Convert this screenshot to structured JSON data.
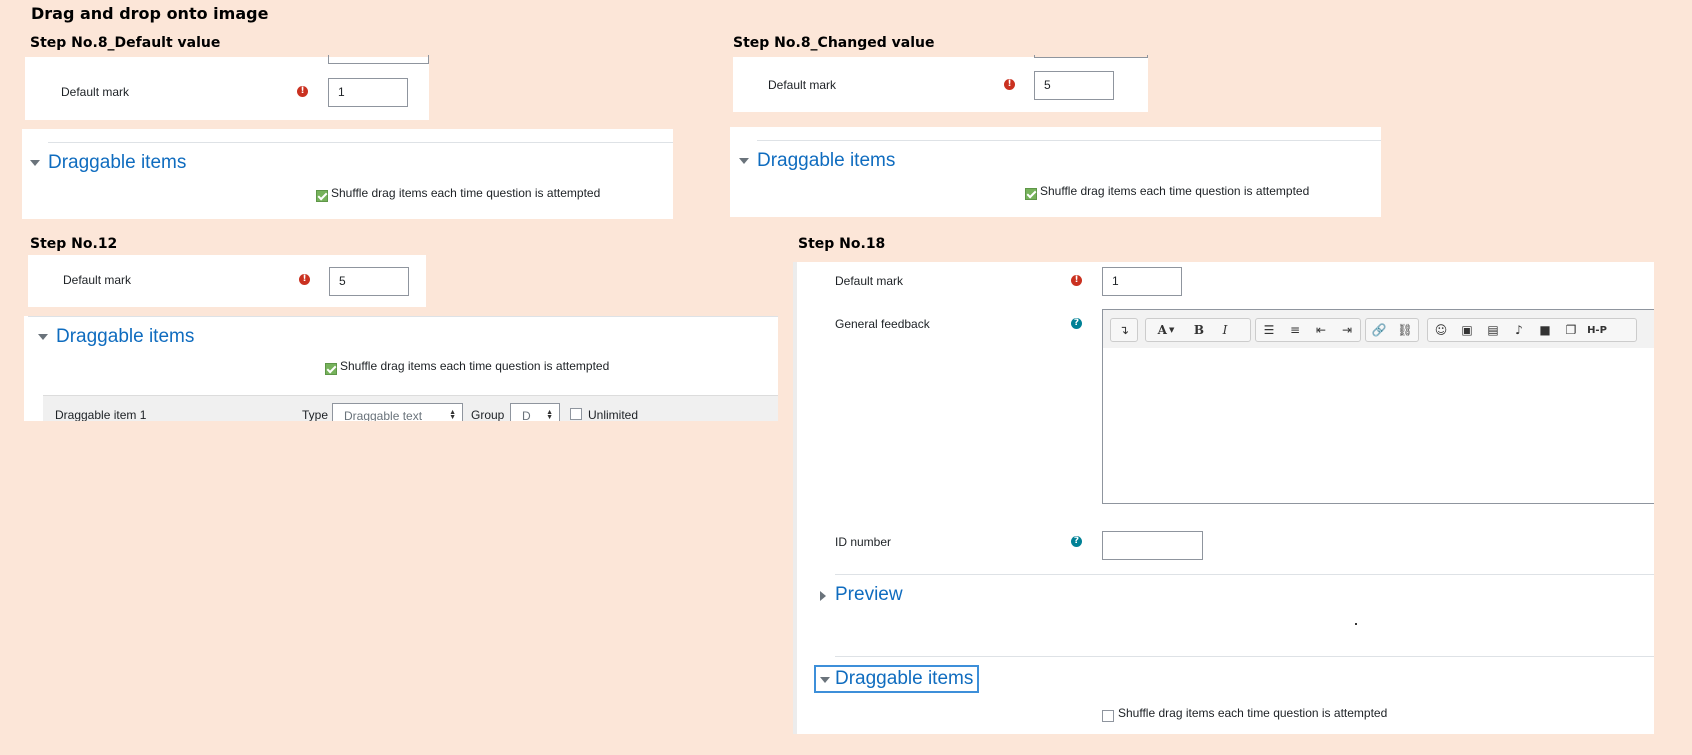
{
  "page_title": "Drag and drop onto image",
  "steps": {
    "step8_default": {
      "heading": "Step No.8_Default value",
      "default_mark_label": "Default mark",
      "default_mark_value": "1",
      "section_title": "Draggable items",
      "shuffle_label": "Shuffle drag items each time question is attempted",
      "shuffle_checked": true
    },
    "step8_changed": {
      "heading": "Step No.8_Changed value",
      "default_mark_label": "Default mark",
      "default_mark_value": "5",
      "section_title": "Draggable items",
      "shuffle_label": "Shuffle drag items each time question is attempted",
      "shuffle_checked": true
    },
    "step12": {
      "heading": "Step No.12",
      "default_mark_label": "Default mark",
      "default_mark_value": "5",
      "section_title": "Draggable items",
      "shuffle_label": "Shuffle drag items each time question is attempted",
      "shuffle_checked": true,
      "item_row": {
        "label": "Draggable item 1",
        "type_label": "Type",
        "type_value": "Draggable text",
        "group_label": "Group",
        "group_value": "D",
        "unlimited_label": "Unlimited"
      }
    },
    "step18": {
      "heading": "Step No.18",
      "default_mark_label": "Default mark",
      "default_mark_value": "1",
      "general_feedback_label": "General feedback",
      "id_number_label": "ID number",
      "id_number_value": "",
      "preview_title": "Preview",
      "section_title": "Draggable items",
      "shuffle_label": "Shuffle drag items each time question is attempted",
      "shuffle_checked": false
    }
  },
  "editor_toolbar": {
    "text": {
      "bold": "B",
      "italic": "I",
      "font": "A",
      "h5p": "H-P"
    }
  },
  "icons": {
    "required": "exclamation-circle-icon",
    "help": "question-circle-icon"
  },
  "colors": {
    "background": "#fce6d8",
    "link_blue": "#0f6cbf",
    "required_red": "#ca3120",
    "help_teal": "#008196",
    "checkbox_green": "#76b25b"
  }
}
